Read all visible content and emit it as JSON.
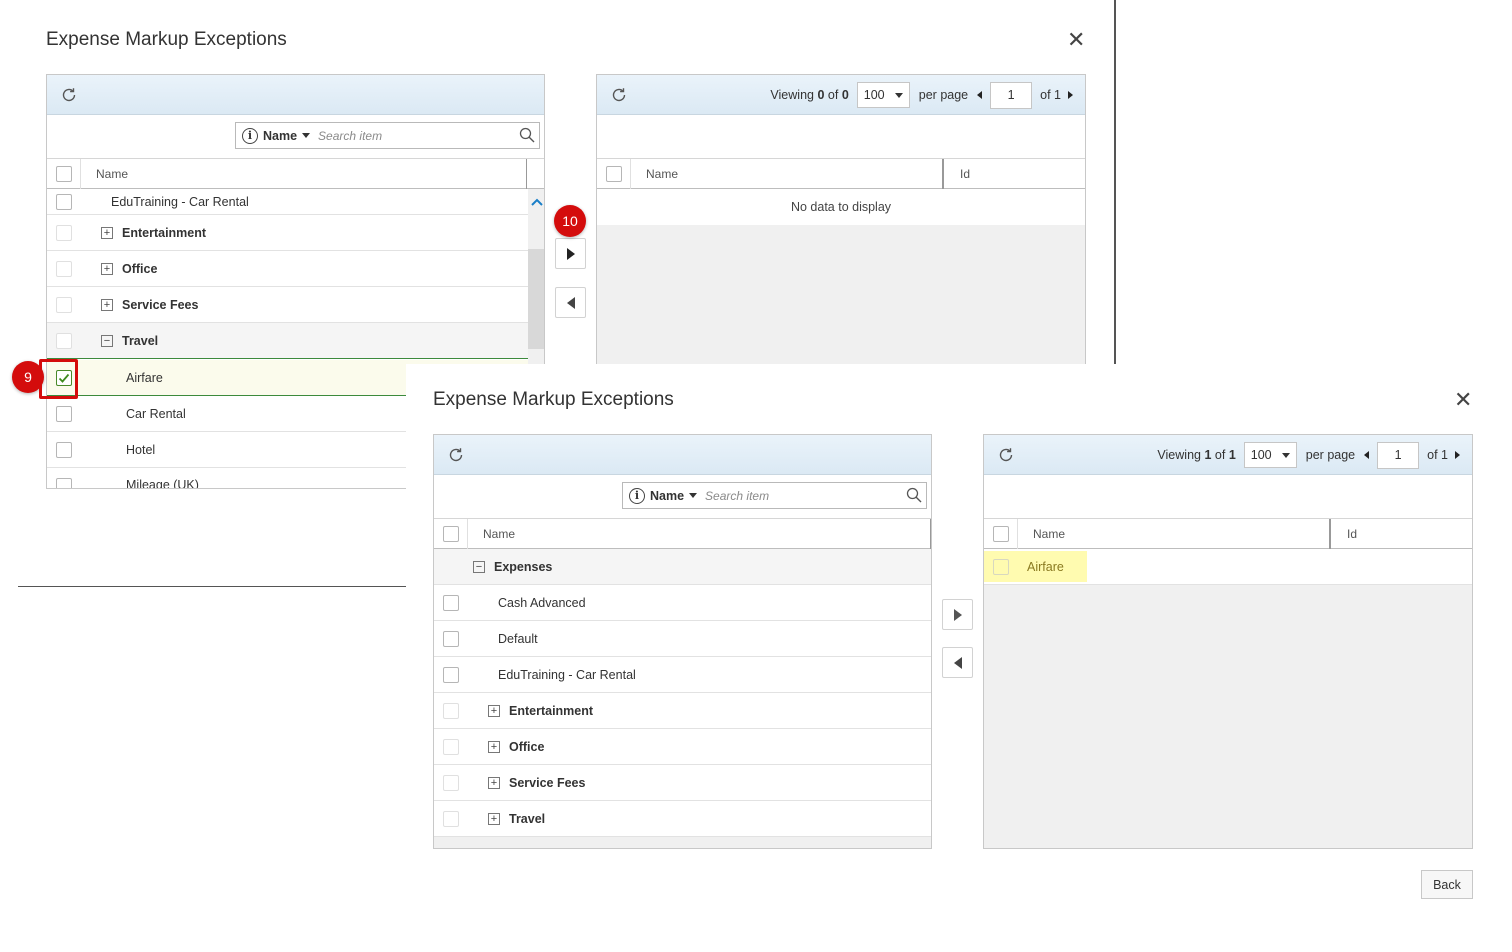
{
  "back_dialog": {
    "title": "Expense Markup Exceptions",
    "left_panel": {
      "search": {
        "field": "Name",
        "placeholder": "Search item"
      },
      "column_name": "Name",
      "rows": [
        {
          "label": "EduTraining - Car Rental",
          "type": "item",
          "checked": false
        },
        {
          "label": "Entertainment",
          "type": "group-collapsed",
          "checked": false
        },
        {
          "label": "Office",
          "type": "group-collapsed",
          "checked": false
        },
        {
          "label": "Service Fees",
          "type": "group-collapsed",
          "checked": false
        },
        {
          "label": "Travel",
          "type": "group-expanded",
          "checked": false
        },
        {
          "label": "Airfare",
          "type": "item",
          "checked": true
        },
        {
          "label": "Car Rental",
          "type": "item",
          "checked": false
        },
        {
          "label": "Hotel",
          "type": "item",
          "checked": false
        },
        {
          "label": "Mileage (UK)",
          "type": "item",
          "checked": false
        }
      ]
    },
    "right_panel": {
      "viewing_label": "Viewing",
      "viewing_from": "0",
      "of_word": "of",
      "viewing_total": "0",
      "per_page_value": "100",
      "per_page_label": "per page",
      "page": "1",
      "of_pages": "of 1",
      "col_name": "Name",
      "col_id": "Id",
      "empty_text": "No data to display"
    },
    "badge_step_9": "9",
    "badge_step_10": "10"
  },
  "front_dialog": {
    "title": "Expense Markup Exceptions",
    "left_panel": {
      "search": {
        "field": "Name",
        "placeholder": "Search item"
      },
      "column_name": "Name",
      "rows": [
        {
          "label": "Expenses",
          "type": "group-expanded-root"
        },
        {
          "label": "Cash Advanced",
          "type": "item"
        },
        {
          "label": "Default",
          "type": "item"
        },
        {
          "label": "EduTraining - Car Rental",
          "type": "item"
        },
        {
          "label": "Entertainment",
          "type": "group-collapsed"
        },
        {
          "label": "Office",
          "type": "group-collapsed"
        },
        {
          "label": "Service Fees",
          "type": "group-collapsed"
        },
        {
          "label": "Travel",
          "type": "group-collapsed"
        }
      ]
    },
    "right_panel": {
      "viewing_label": "Viewing",
      "viewing_from": "1",
      "of_word": "of",
      "viewing_total": "1",
      "per_page_value": "100",
      "per_page_label": "per page",
      "page": "1",
      "of_pages": "of 1",
      "col_name": "Name",
      "col_id": "Id",
      "rows": [
        {
          "name": "Airfare",
          "id": ""
        }
      ]
    },
    "back_label": "Back"
  },
  "colors": {
    "highlight": "#fffbb0",
    "badge_red": "#d40c0c",
    "selected_row": "#fbfbec",
    "check_green": "#4a8a2a"
  }
}
